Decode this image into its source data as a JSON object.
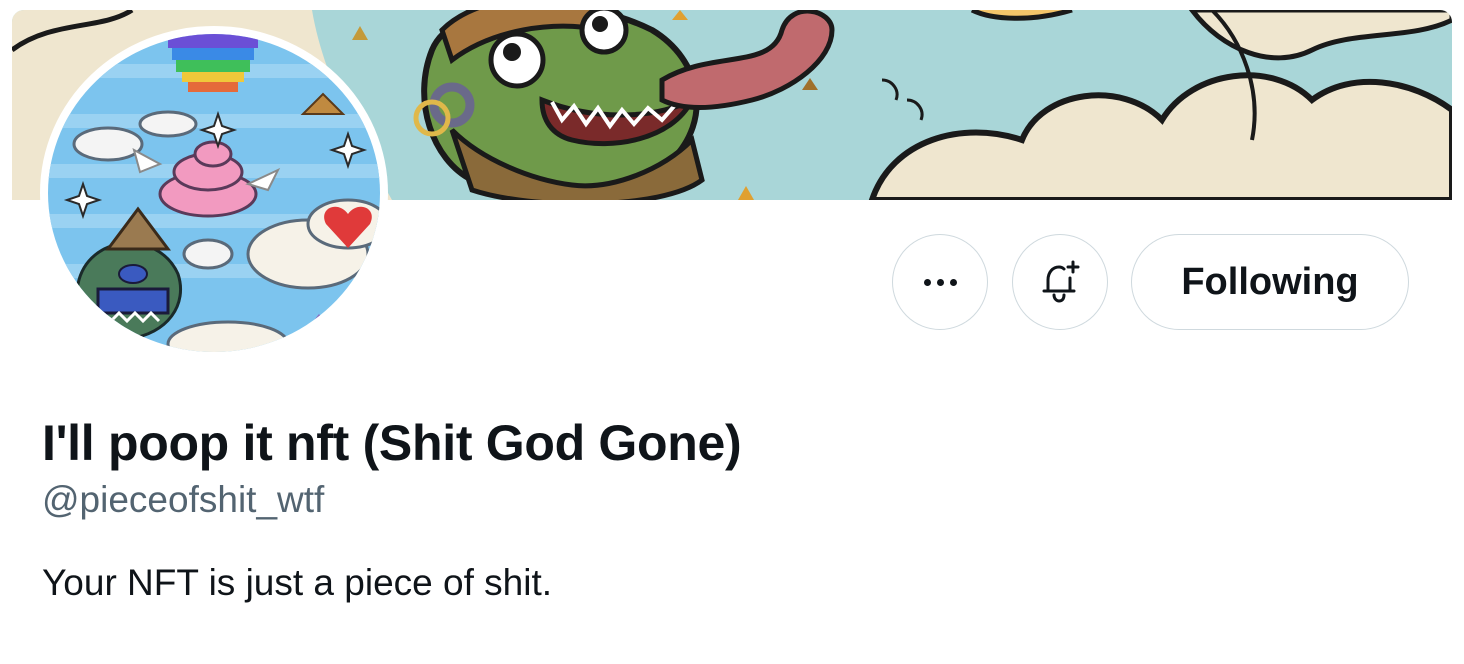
{
  "profile": {
    "display_name": "I'll poop it nft (Shit God Gone)",
    "handle": "@pieceofshit_wtf",
    "bio": "Your NFT is just a piece of shit."
  },
  "actions": {
    "more_icon": "more-horizontal-icon",
    "notify_icon": "bell-plus-icon",
    "follow_label": "Following"
  },
  "colors": {
    "text_primary": "#0f1419",
    "text_secondary": "#536471",
    "border": "#cfd9de",
    "banner_sky": "#a9d6d8",
    "banner_sand": "#efe6cf"
  }
}
